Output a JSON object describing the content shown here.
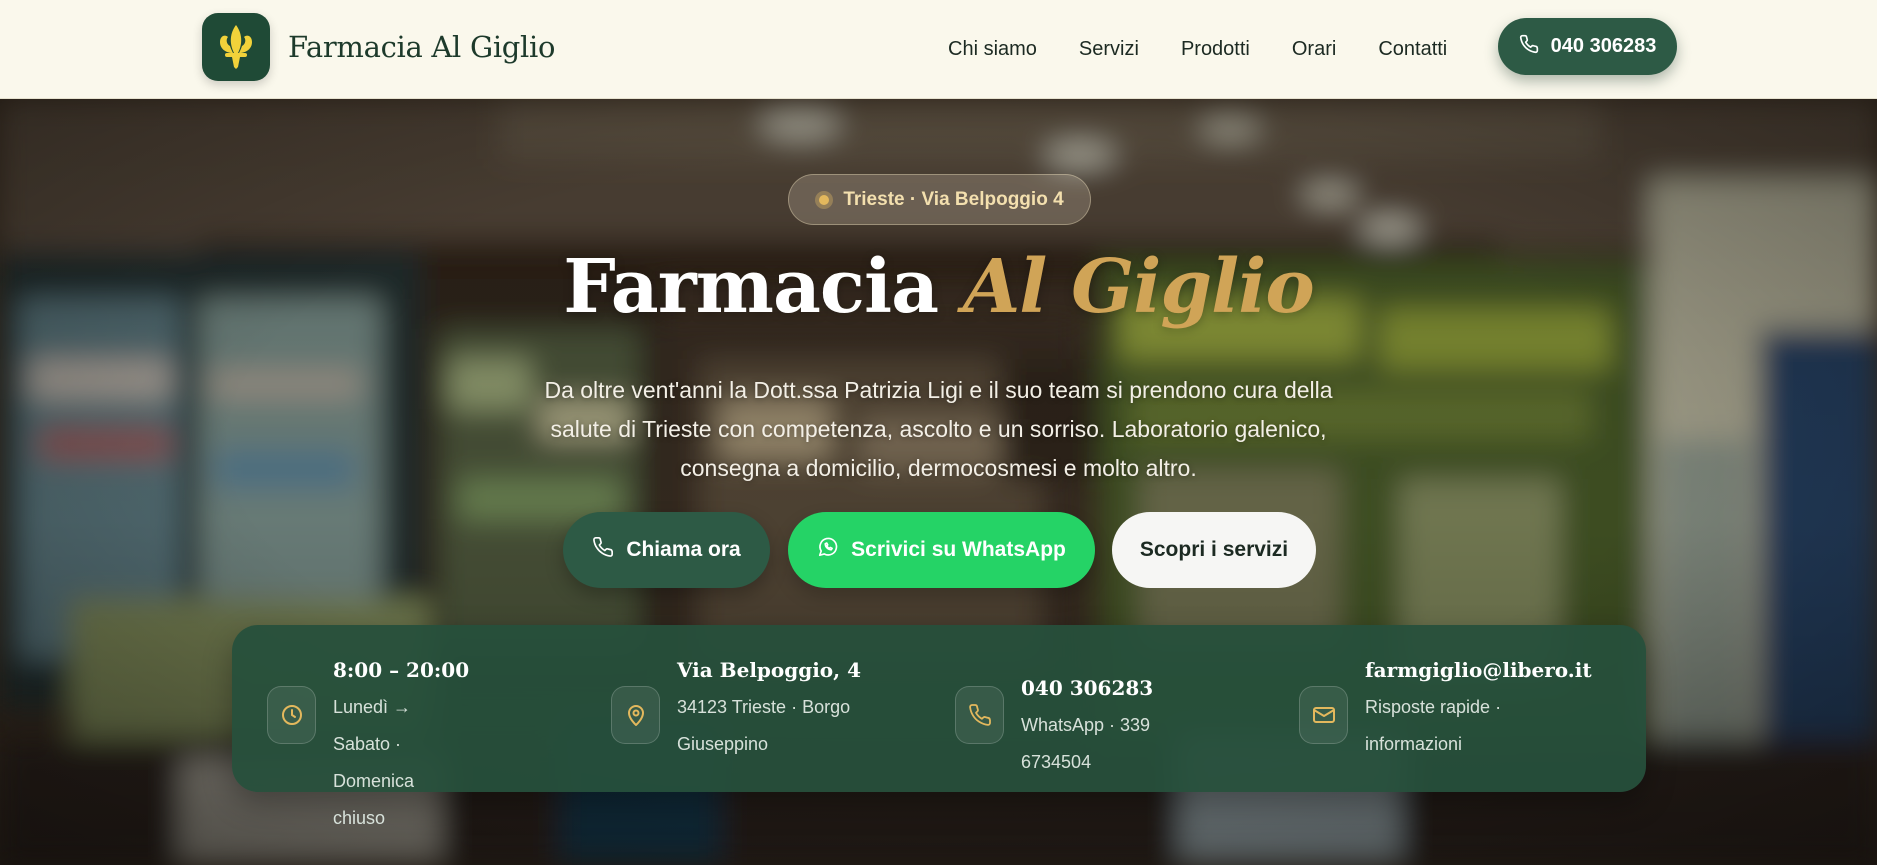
{
  "nav": {
    "brand_name": "Farmacia Al Giglio",
    "links": [
      "Chi siamo",
      "Servizi",
      "Prodotti",
      "Orari",
      "Contatti"
    ],
    "phone": "040 306283"
  },
  "hero": {
    "location_badge": "Trieste · Via Belpoggio 4",
    "title_plain": "Farmacia",
    "title_accent": "Al Giglio",
    "description": "Da oltre vent'anni la Dott.ssa Patrizia Ligi e il suo team si prendono cura della salute di Trieste con competenza, ascolto e un sorriso. Laboratorio galenico, consegna a domicilio, dermocosmesi e molto altro.",
    "buttons": {
      "call": "Chiama ora",
      "whatsapp": "Scrivici su WhatsApp",
      "services": "Scopri i servizi"
    }
  },
  "info": [
    {
      "icon": "clock-icon",
      "title": "8:00 – 20:00",
      "lines": [
        "Lunedì → Sabato · Domenica",
        "chiuso"
      ]
    },
    {
      "icon": "map-pin-icon",
      "title": "Via Belpoggio, 4",
      "lines": [
        "34123 Trieste · Borgo",
        "Giuseppino"
      ]
    },
    {
      "icon": "phone-icon",
      "title": "040 306283",
      "lines": [
        "WhatsApp · 339 6734504"
      ]
    },
    {
      "icon": "mail-icon",
      "title": "farmgiglio@libero.it",
      "lines": [
        "Risposte rapide ·",
        "informazioni"
      ]
    }
  ],
  "colors": {
    "nav_bg": "#faf8ec",
    "brand_green": "#2d5a45",
    "whatsapp_green": "#25d366",
    "gold_accent": "#d0a457",
    "info_card": "#26503c"
  }
}
